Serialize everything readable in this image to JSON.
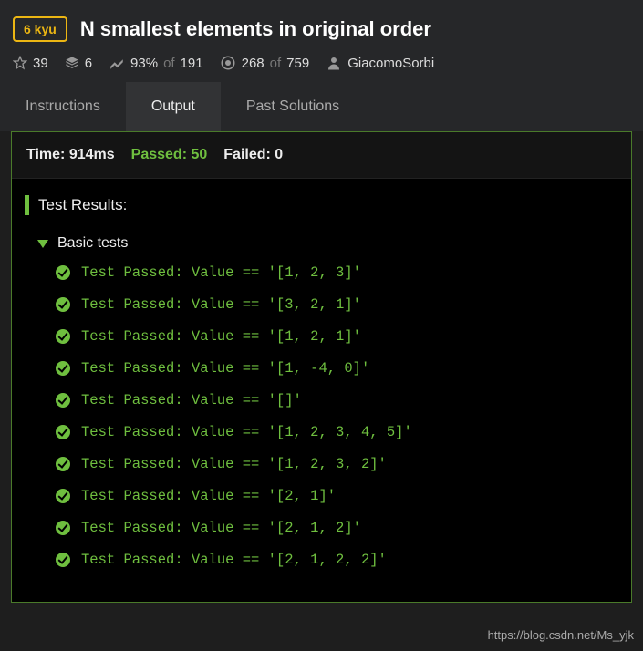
{
  "header": {
    "kyu": "6 kyu",
    "title": "N smallest elements in original order"
  },
  "stats": {
    "stars": "39",
    "layers": "6",
    "satisfaction_pct": "93%",
    "satisfaction_of_word": "of",
    "satisfaction_total": "191",
    "completed": "268",
    "completed_of_word": "of",
    "completed_total": "759",
    "author": "GiacomoSorbi"
  },
  "tabs": {
    "instructions": "Instructions",
    "output": "Output",
    "past_solutions": "Past Solutions"
  },
  "summary": {
    "time_label": "Time: 914ms",
    "passed_label": "Passed: 50",
    "failed_label": "Failed: 0"
  },
  "results": {
    "header": "Test Results:",
    "group": "Basic tests",
    "tests": [
      "Test Passed: Value == '[1, 2, 3]'",
      "Test Passed: Value == '[3, 2, 1]'",
      "Test Passed: Value == '[1, 2, 1]'",
      "Test Passed: Value == '[1, -4, 0]'",
      "Test Passed: Value == '[]'",
      "Test Passed: Value == '[1, 2, 3, 4, 5]'",
      "Test Passed: Value == '[1, 2, 3, 2]'",
      "Test Passed: Value == '[2, 1]'",
      "Test Passed: Value == '[2, 1, 2]'",
      "Test Passed: Value == '[2, 1, 2, 2]'"
    ]
  },
  "watermark": "https://blog.csdn.net/Ms_yjk"
}
